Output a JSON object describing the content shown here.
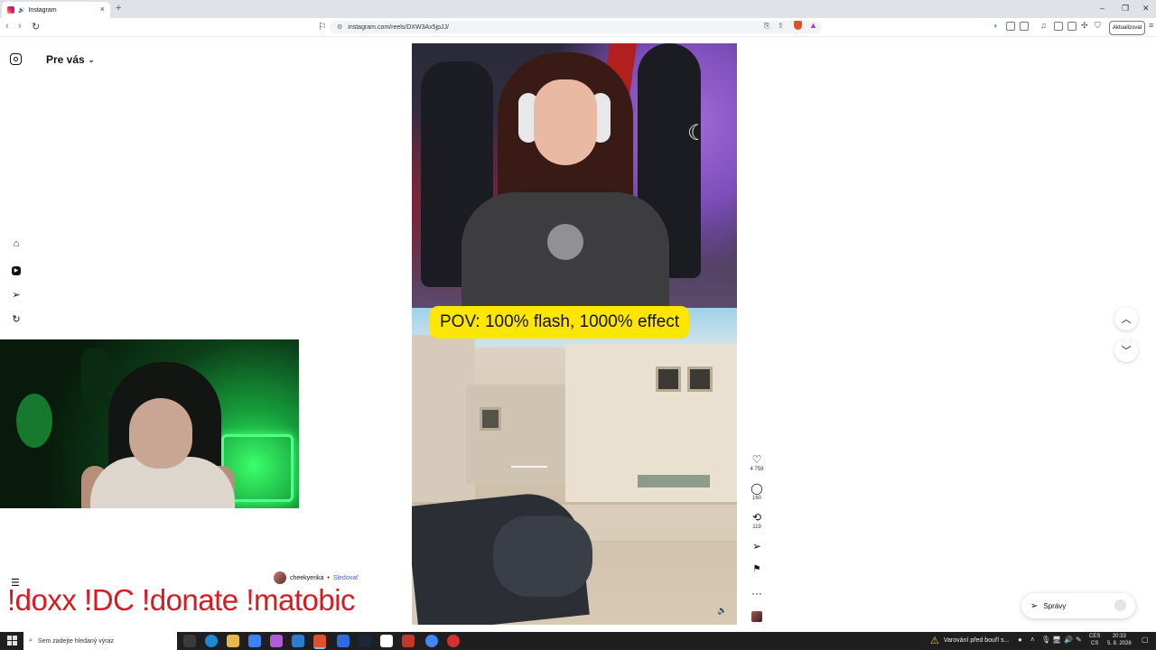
{
  "browser": {
    "tab_title": "Instagram",
    "tab_close": "×",
    "new_tab": "+",
    "url": "instagram.com/reels/DXW3Ax5jpJJ/",
    "update_button": "Aktualizovat",
    "window_controls": [
      "–",
      "❐",
      "✕"
    ]
  },
  "instagram": {
    "feed_selector": "Pre vás",
    "nav_icons": [
      "home-icon",
      "reels-icon",
      "send-icon",
      "threads-icon"
    ],
    "reel": {
      "caption_banner": "POV: 100% flash, 1000% effect",
      "actions": [
        {
          "name": "like",
          "icon": "♡",
          "count": "4 759"
        },
        {
          "name": "comment",
          "icon": "◯",
          "count": "160"
        },
        {
          "name": "repost",
          "icon": "⟲",
          "count": "119"
        },
        {
          "name": "share",
          "icon": "➢",
          "count": ""
        },
        {
          "name": "save",
          "icon": "🔖",
          "count": ""
        },
        {
          "name": "more",
          "icon": "···",
          "count": ""
        }
      ],
      "author": "cheekyerika",
      "separator": "•",
      "follow_label": "Sledovať"
    },
    "messages_label": "Správy"
  },
  "stream_overlay": {
    "commands": "!doxx  !DC !donate !matobic"
  },
  "taskbar": {
    "search_placeholder": "Sem zadejte hledaný výraz",
    "warning": "Varování před bouří s...",
    "lang_top": "CES",
    "lang_bottom": "CS",
    "time": "20:33",
    "date": "5. 8. 2026"
  },
  "colors": {
    "caption_yellow": "#ffe600",
    "command_red": "#d81b22",
    "follow_blue": "#4a5bd6"
  }
}
